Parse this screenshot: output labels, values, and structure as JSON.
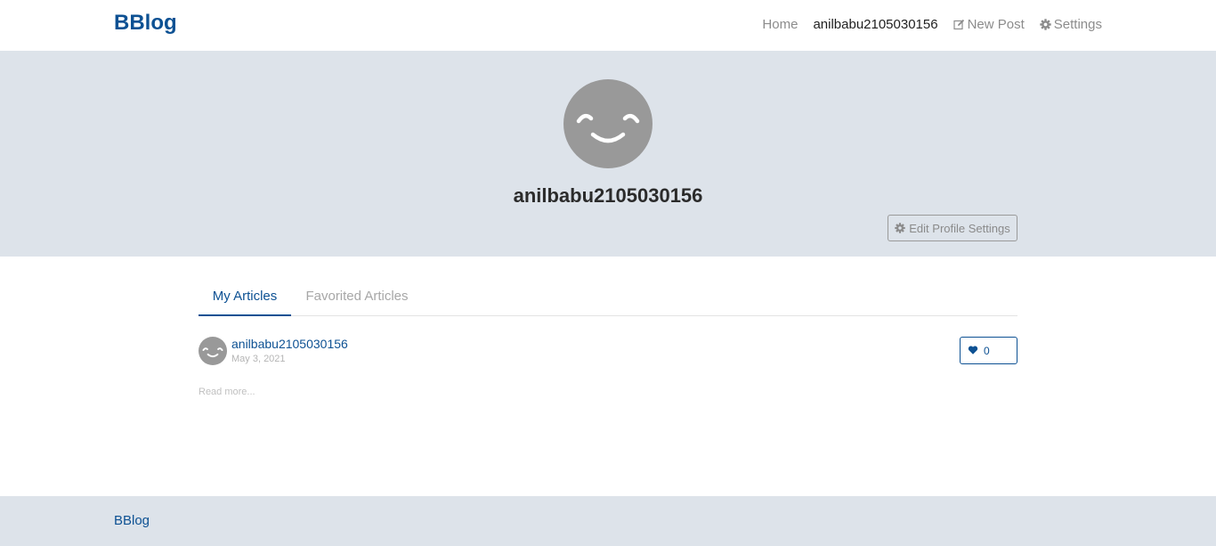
{
  "navbar": {
    "brand": "BBlog",
    "links": {
      "home": "Home",
      "profile": "anilbabu2105030156",
      "new_post": "New Post",
      "settings": "Settings"
    }
  },
  "profile": {
    "username": "anilbabu2105030156",
    "edit_button": "Edit Profile Settings",
    "avatar_icon": "smiley-face-icon"
  },
  "tabs": {
    "my_articles": "My Articles",
    "favorited_articles": "Favorited Articles"
  },
  "article": {
    "author": "anilbabu2105030156",
    "date": "May 3, 2021",
    "likes": "0",
    "read_more": "Read more..."
  },
  "footer": {
    "brand": "BBlog"
  },
  "colors": {
    "brand": "#0d5193",
    "banner_bg": "#dde3ea",
    "avatar_bg": "#999999",
    "muted_text": "#8c8c8c"
  }
}
